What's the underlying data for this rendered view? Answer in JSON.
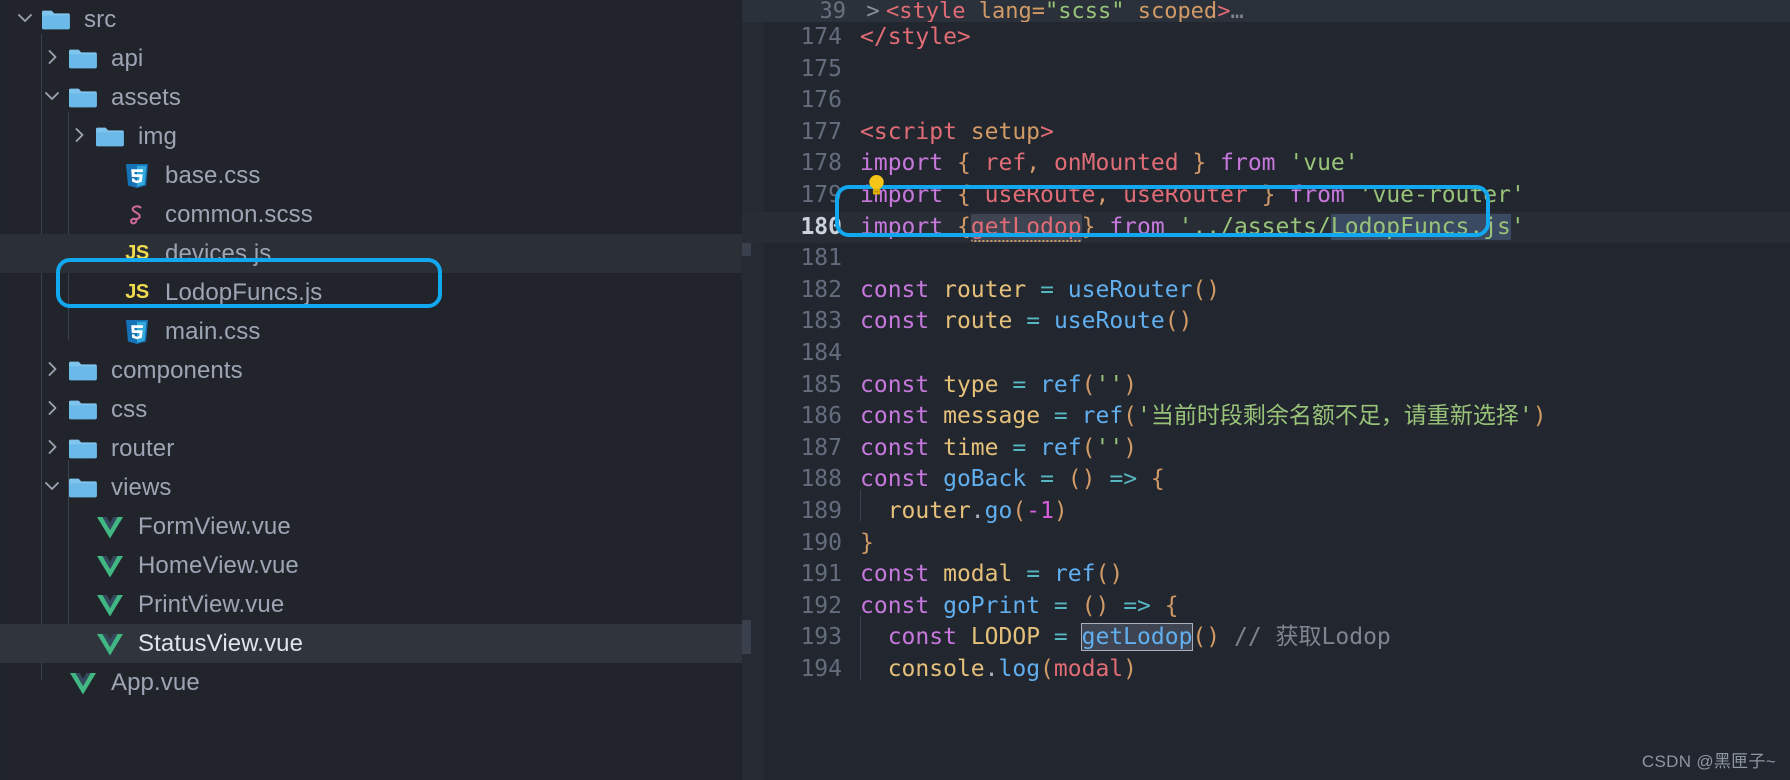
{
  "app": {
    "theme_bg": "#22262e",
    "sidebar_bg": "#21252b",
    "accent": "#12a8f0"
  },
  "sidebar": {
    "items": [
      {
        "label": "src",
        "icon": "folder-icon",
        "twisty": "chevron-down",
        "indent": 0,
        "state": "normal"
      },
      {
        "label": "api",
        "icon": "folder-icon",
        "twisty": "chevron-right",
        "indent": 1,
        "state": "normal"
      },
      {
        "label": "assets",
        "icon": "folder-icon",
        "twisty": "chevron-down",
        "indent": 1,
        "state": "normal"
      },
      {
        "label": "img",
        "icon": "folder-icon",
        "twisty": "chevron-right",
        "indent": 2,
        "state": "normal"
      },
      {
        "label": "base.css",
        "icon": "css-file-icon",
        "twisty": "none",
        "indent": 3,
        "state": "normal"
      },
      {
        "label": "common.scss",
        "icon": "sass-file-icon",
        "twisty": "none",
        "indent": 3,
        "state": "normal"
      },
      {
        "label": "devices.js",
        "icon": "js-file-icon",
        "twisty": "none",
        "indent": 3,
        "state": "hovered"
      },
      {
        "label": "LodopFuncs.js",
        "icon": "js-file-icon",
        "twisty": "none",
        "indent": 3,
        "state": "annotated"
      },
      {
        "label": "main.css",
        "icon": "css-file-icon",
        "twisty": "none",
        "indent": 3,
        "state": "normal"
      },
      {
        "label": "components",
        "icon": "folder-icon",
        "twisty": "chevron-right",
        "indent": 1,
        "state": "normal"
      },
      {
        "label": "css",
        "icon": "folder-icon",
        "twisty": "chevron-right",
        "indent": 1,
        "state": "normal"
      },
      {
        "label": "router",
        "icon": "folder-icon",
        "twisty": "chevron-right",
        "indent": 1,
        "state": "normal"
      },
      {
        "label": "views",
        "icon": "folder-icon",
        "twisty": "chevron-down",
        "indent": 1,
        "state": "normal"
      },
      {
        "label": "FormView.vue",
        "icon": "vue-file-icon",
        "twisty": "none",
        "indent": 2,
        "state": "normal"
      },
      {
        "label": "HomeView.vue",
        "icon": "vue-file-icon",
        "twisty": "none",
        "indent": 2,
        "state": "normal"
      },
      {
        "label": "PrintView.vue",
        "icon": "vue-file-icon",
        "twisty": "none",
        "indent": 2,
        "state": "normal"
      },
      {
        "label": "StatusView.vue",
        "icon": "vue-file-icon",
        "twisty": "none",
        "indent": 2,
        "state": "selected"
      },
      {
        "label": "App.vue",
        "icon": "vue-file-icon",
        "twisty": "none",
        "indent": 1,
        "state": "normal"
      }
    ]
  },
  "editor": {
    "sticky_line_number": "39",
    "sticky_text": "<style lang=\"scss\" scoped>…",
    "active_line": "180",
    "lines": [
      {
        "n": "174",
        "text": "</style>"
      },
      {
        "n": "175",
        "text": ""
      },
      {
        "n": "176",
        "text": ""
      },
      {
        "n": "177",
        "text": "<script setup>"
      },
      {
        "n": "178",
        "text": "import { ref, onMounted } from 'vue'"
      },
      {
        "n": "179",
        "text": "import { useRoute, useRouter } from 'vue-router'"
      },
      {
        "n": "180",
        "text": "import {getLodop} from '../assets/LodopFuncs.js'"
      },
      {
        "n": "181",
        "text": ""
      },
      {
        "n": "182",
        "text": "const router = useRouter()"
      },
      {
        "n": "183",
        "text": "const route = useRoute()"
      },
      {
        "n": "184",
        "text": ""
      },
      {
        "n": "185",
        "text": "const type = ref('')"
      },
      {
        "n": "186",
        "text": "const message = ref('当前时段剩余名额不足，请重新选择')"
      },
      {
        "n": "187",
        "text": "const time = ref('')"
      },
      {
        "n": "188",
        "text": "const goBack = () => {"
      },
      {
        "n": "189",
        "text": "  router.go(-1)"
      },
      {
        "n": "190",
        "text": "}"
      },
      {
        "n": "191",
        "text": "const modal = ref()"
      },
      {
        "n": "192",
        "text": "const goPrint = () => {"
      },
      {
        "n": "193",
        "text": "  const LODOP = getLodop() // 获取Lodop"
      },
      {
        "n": "194",
        "text": "  console.log(modal)"
      }
    ],
    "tokens": {
      "style_close": "</style>",
      "script_open_tag_lt": "<",
      "script_open_name": "script",
      "script_open_attr": "setup",
      "script_open_gt": ">",
      "kw_import": "import",
      "kw_const": "const",
      "kw_from": "from",
      "b_open": "{",
      "b_close": "}",
      "id_ref": "ref",
      "id_onMounted": "onMounted",
      "id_useRoute": "useRoute",
      "id_useRouter": "useRouter",
      "id_getLodop": "getLodop",
      "str_vue": "'vue'",
      "str_vue_router": "'vue-router'",
      "str_lodop_path": "'../assets/LodopFuncs.js'",
      "var_router": "router",
      "var_route": "route",
      "var_type": "type",
      "var_message": "message",
      "var_time": "time",
      "var_goBack": "goBack",
      "var_modal": "modal",
      "var_goPrint": "goPrint",
      "var_LODOP": "LODOP",
      "empty_string": "''",
      "message_string": "'当前时段剩余名额不足，请重新选择'",
      "arrow": "=>",
      "equals": "=",
      "comma": ",",
      "paren_open": "(",
      "paren_close": ")",
      "paren_pair": "()",
      "neg_one": "-1",
      "dot_go": ".go",
      "dot_log": ".log",
      "id_console": "console",
      "comment_getlodop": "// 获取Lodop",
      "brace_open": "{",
      "brace_close": "}"
    }
  },
  "annotations": {
    "sidebar_box_label": "LodopFuncs.js",
    "editor_box_label": "import {getLodop} from '../assets/LodopFuncs.js'",
    "box_color": "#12a8f0"
  },
  "watermark": {
    "text": "CSDN @黑匣子~"
  }
}
